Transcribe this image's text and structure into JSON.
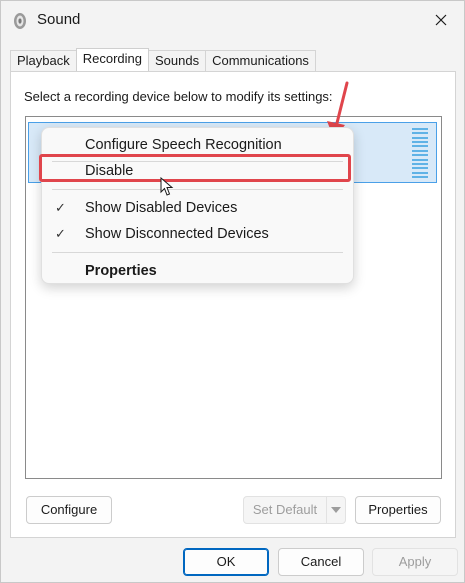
{
  "window": {
    "title": "Sound"
  },
  "tabs": [
    {
      "label": "Playback"
    },
    {
      "label": "Recording"
    },
    {
      "label": "Sounds"
    },
    {
      "label": "Communications"
    }
  ],
  "active_tab": "Recording",
  "instruction": "Select a recording device below to modify its settings:",
  "context_menu": {
    "items": [
      {
        "label": "Configure Speech Recognition",
        "checked": false
      },
      {
        "label": "Disable",
        "checked": false
      },
      {
        "label": "Show Disabled Devices",
        "checked": true
      },
      {
        "label": "Show Disconnected Devices",
        "checked": true
      },
      {
        "label": "Properties",
        "checked": false,
        "bold": true
      }
    ],
    "check_glyph": "✓"
  },
  "panel_buttons": {
    "configure": "Configure",
    "set_default": "Set Default",
    "properties": "Properties"
  },
  "dialog_buttons": {
    "ok": "OK",
    "cancel": "Cancel",
    "apply": "Apply"
  },
  "colors": {
    "accent": "#0067c0",
    "highlight": "#e0454c",
    "selection": "#d8e9f8"
  }
}
